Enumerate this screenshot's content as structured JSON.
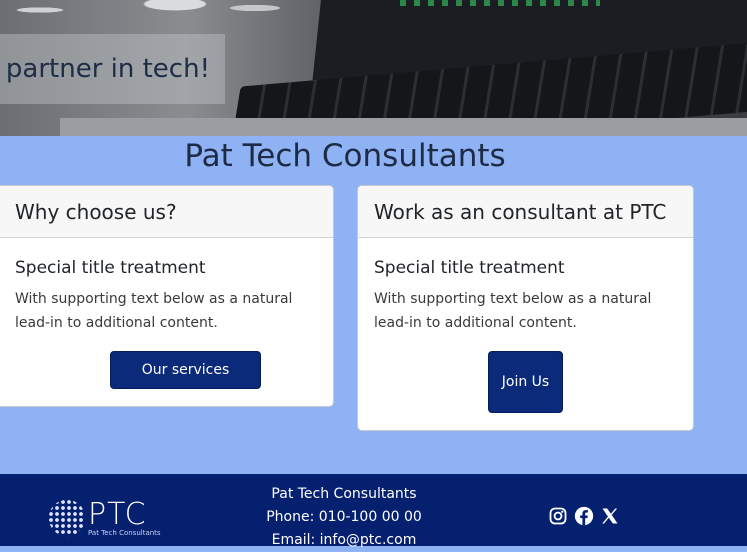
{
  "hero": {
    "tagline": "Your partner in tech!"
  },
  "main": {
    "title": "Pat Tech Consultants",
    "cards": [
      {
        "header": "Why choose us?",
        "title": "Special title treatment",
        "text": "With supporting text below as a natural lead-in to additional content.",
        "button": "Our services"
      },
      {
        "header": "Work as an consultant at PTC",
        "title": "Special title treatment",
        "text": "With supporting text below as a natural lead-in to additional content.",
        "button": "Join Us"
      }
    ]
  },
  "footer": {
    "logo_text": "PTC",
    "logo_sub": "Pat Tech Consultants",
    "company": "Pat Tech Consultants",
    "phone": "Phone: 010-100 00 00",
    "email": "Email: info@ptc.com",
    "social": [
      "instagram-icon",
      "facebook-icon",
      "x-icon"
    ]
  },
  "colors": {
    "page_background": "#8fb2f4",
    "brand_navy": "#062070",
    "button": "#0b2a7a"
  }
}
